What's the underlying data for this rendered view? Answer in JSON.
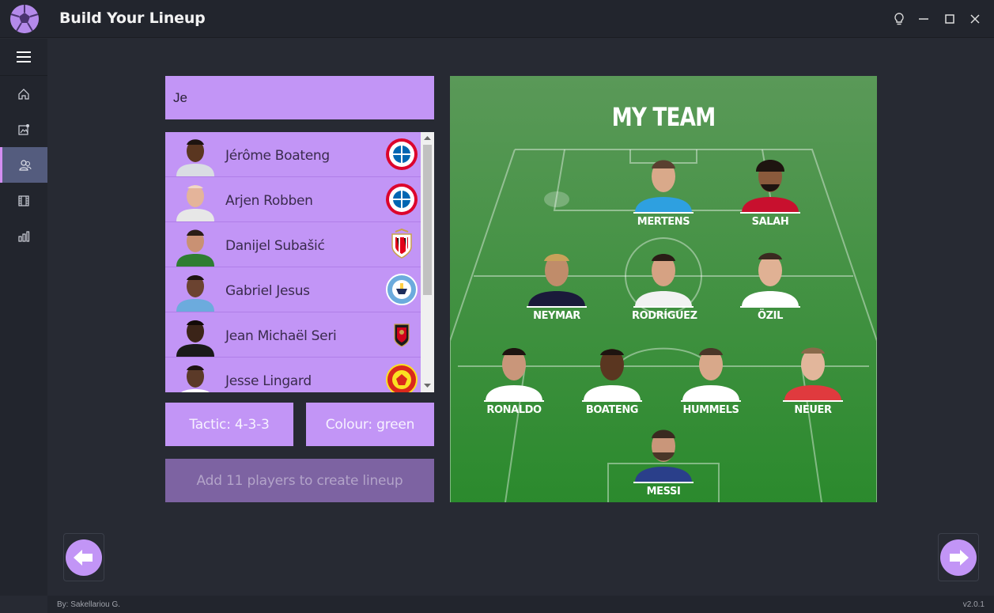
{
  "app": {
    "title": "Build Your Lineup"
  },
  "search": {
    "value": "Je"
  },
  "players": [
    {
      "name": "Jérôme Boateng",
      "club_icon": "bayern-badge-icon"
    },
    {
      "name": "Arjen Robben",
      "club_icon": "bayern-badge-icon"
    },
    {
      "name": "Danijel Subašić",
      "club_icon": "monaco-badge-icon"
    },
    {
      "name": "Gabriel Jesus",
      "club_icon": "mancity-badge-icon"
    },
    {
      "name": "Jean Michaël Seri",
      "club_icon": "nice-badge-icon"
    },
    {
      "name": "Jesse Lingard",
      "club_icon": "manutd-badge-icon"
    }
  ],
  "buttons": {
    "tactic": "Tactic: 4-3-3",
    "colour": "Colour: green",
    "create": "Add 11 players to create lineup"
  },
  "pitch": {
    "title": "MY TEAM",
    "lineup": [
      "MERTENS",
      "SALAH",
      "NEYMAR",
      "RODRÍGUEZ",
      "ÖZIL",
      "RONALDO",
      "BOATENG",
      "HUMMELS",
      "NEUER",
      "MESSI"
    ]
  },
  "footer": {
    "author": "By: Sakellariou G.",
    "version": "v2.0.1"
  },
  "colors": {
    "accent": "#c295f6",
    "active_nav": "#545c7e",
    "pitch_top": "#5a9958",
    "pitch_bottom": "#2b8a2d"
  }
}
